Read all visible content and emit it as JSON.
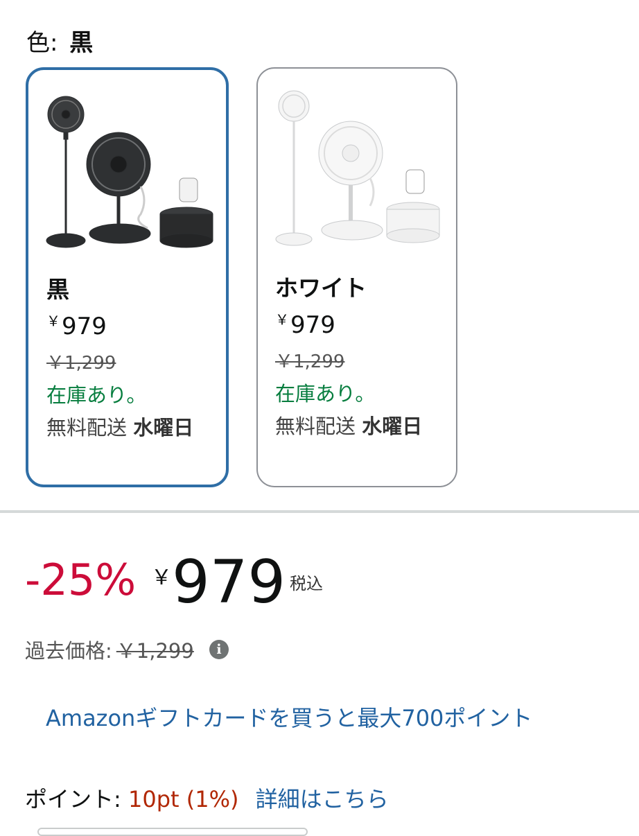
{
  "color_selector": {
    "label": "色:",
    "selected": "黒"
  },
  "swatches": [
    {
      "name": "黒",
      "price_symbol": "￥",
      "price": "979",
      "old_price": "￥1,299",
      "stock": "在庫あり。",
      "shipping_prefix": "無料配送",
      "shipping_day": "水曜日",
      "product_color": "#2b2d2f",
      "selected": true
    },
    {
      "name": "ホワイト",
      "price_symbol": "￥",
      "price": "979",
      "old_price": "￥1,299",
      "stock": "在庫あり。",
      "shipping_prefix": "無料配送",
      "shipping_day": "水曜日",
      "product_color": "#e9eaeb",
      "selected": false
    }
  ],
  "price_block": {
    "discount": "-25%",
    "currency": "￥",
    "amount": "979",
    "tax_note": "税込",
    "past_price_label": "過去価格:",
    "past_price": "￥1,299",
    "info_icon": "i"
  },
  "gift_card_promo": "Amazonギフトカードを買うと最大700ポイント",
  "points": {
    "label": "ポイント:",
    "value": "10pt",
    "percent": "(1%)",
    "details_link": "詳細はこちら"
  },
  "colors": {
    "selected_border": "#2f6ea6",
    "discount_red": "#cc0c39",
    "stock_green": "#067d3e",
    "link_blue": "#2162a1"
  }
}
